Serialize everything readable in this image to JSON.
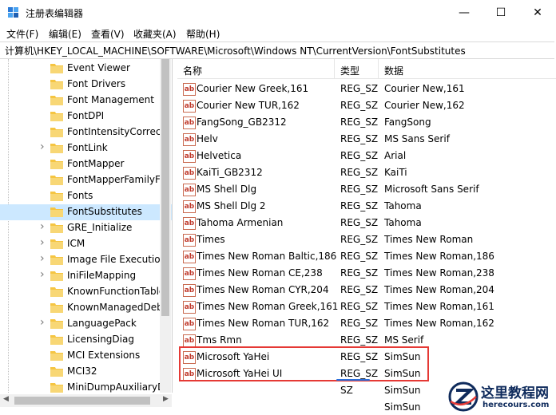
{
  "window": {
    "title": "注册表编辑器",
    "controls": {
      "minimize": "—",
      "maximize": "☐",
      "close": "✕"
    }
  },
  "menu": [
    "文件(F)",
    "编辑(E)",
    "查看(V)",
    "收藏夹(A)",
    "帮助(H)"
  ],
  "address": "计算机\\HKEY_LOCAL_MACHINE\\SOFTWARE\\Microsoft\\Windows NT\\CurrentVersion\\FontSubstitutes",
  "tree": {
    "items": [
      {
        "label": "Event Viewer",
        "expandable": false,
        "selected": false
      },
      {
        "label": "Font Drivers",
        "expandable": false,
        "selected": false
      },
      {
        "label": "Font Management",
        "expandable": false,
        "selected": false
      },
      {
        "label": "FontDPI",
        "expandable": false,
        "selected": false
      },
      {
        "label": "FontIntensityCorrect",
        "expandable": false,
        "selected": false
      },
      {
        "label": "FontLink",
        "expandable": true,
        "selected": false
      },
      {
        "label": "FontMapper",
        "expandable": false,
        "selected": false
      },
      {
        "label": "FontMapperFamilyFa",
        "expandable": false,
        "selected": false
      },
      {
        "label": "Fonts",
        "expandable": false,
        "selected": false
      },
      {
        "label": "FontSubstitutes",
        "expandable": false,
        "selected": true
      },
      {
        "label": "GRE_Initialize",
        "expandable": true,
        "selected": false
      },
      {
        "label": "ICM",
        "expandable": true,
        "selected": false
      },
      {
        "label": "Image File Executio",
        "expandable": true,
        "selected": false
      },
      {
        "label": "IniFileMapping",
        "expandable": true,
        "selected": false
      },
      {
        "label": "KnownFunctionTable",
        "expandable": false,
        "selected": false
      },
      {
        "label": "KnownManagedDeb",
        "expandable": false,
        "selected": false
      },
      {
        "label": "LanguagePack",
        "expandable": true,
        "selected": false
      },
      {
        "label": "LicensingDiag",
        "expandable": false,
        "selected": false
      },
      {
        "label": "MCI Extensions",
        "expandable": false,
        "selected": false
      },
      {
        "label": "MCI32",
        "expandable": false,
        "selected": false
      },
      {
        "label": "MiniDumpAuxiliaryD",
        "expandable": false,
        "selected": false
      }
    ]
  },
  "list": {
    "headers": {
      "name": "名称",
      "type": "类型",
      "data": "数据"
    },
    "icon_text": "ab",
    "rows": [
      {
        "name": "Courier New Greek,161",
        "type": "REG_SZ",
        "data": "Courier New,161"
      },
      {
        "name": "Courier New TUR,162",
        "type": "REG_SZ",
        "data": "Courier New,162"
      },
      {
        "name": "FangSong_GB2312",
        "type": "REG_SZ",
        "data": "FangSong"
      },
      {
        "name": "Helv",
        "type": "REG_SZ",
        "data": "MS Sans Serif"
      },
      {
        "name": "Helvetica",
        "type": "REG_SZ",
        "data": "Arial"
      },
      {
        "name": "KaiTi_GB2312",
        "type": "REG_SZ",
        "data": "KaiTi"
      },
      {
        "name": "MS Shell Dlg",
        "type": "REG_SZ",
        "data": "Microsoft Sans Serif"
      },
      {
        "name": "MS Shell Dlg 2",
        "type": "REG_SZ",
        "data": "Tahoma"
      },
      {
        "name": "Tahoma Armenian",
        "type": "REG_SZ",
        "data": "Tahoma"
      },
      {
        "name": "Times",
        "type": "REG_SZ",
        "data": "Times New Roman"
      },
      {
        "name": "Times New Roman Baltic,186",
        "type": "REG_SZ",
        "data": "Times New Roman,186"
      },
      {
        "name": "Times New Roman CE,238",
        "type": "REG_SZ",
        "data": "Times New Roman,238"
      },
      {
        "name": "Times New Roman CYR,204",
        "type": "REG_SZ",
        "data": "Times New Roman,204"
      },
      {
        "name": "Times New Roman Greek,161",
        "type": "REG_SZ",
        "data": "Times New Roman,161"
      },
      {
        "name": "Times New Roman TUR,162",
        "type": "REG_SZ",
        "data": "Times New Roman,162"
      },
      {
        "name": "Tms Rmn",
        "type": "REG_SZ",
        "data": "MS Serif"
      },
      {
        "name": "Microsoft YaHei",
        "type": "REG_SZ",
        "data": "SimSun"
      },
      {
        "name": "Microsoft YaHei UI",
        "type": "REG_SZ",
        "data": "SimSun"
      },
      {
        "name": "",
        "type": "SZ",
        "data": "SimSun"
      },
      {
        "name": "",
        "type": "",
        "data": "SimSun"
      }
    ]
  },
  "watermark": {
    "title": "这里教程网",
    "url": "herecours.com"
  },
  "colors": {
    "highlight_box": "#e53935",
    "selection": "#cce8ff",
    "folder": "#f5c542"
  }
}
